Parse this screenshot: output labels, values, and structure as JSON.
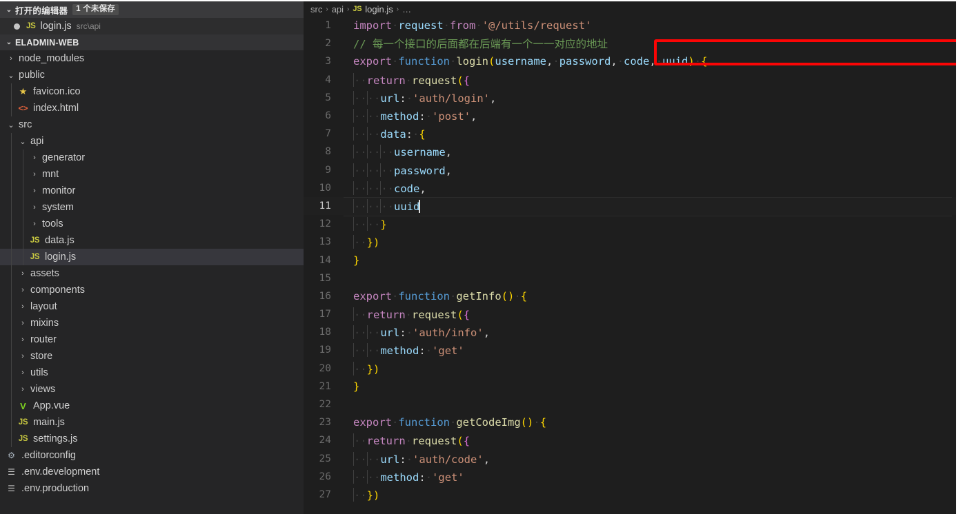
{
  "sidebar": {
    "open_editors": {
      "title": "打开的编辑器",
      "badge": "1 个未保存",
      "chevron": "⌄",
      "items": [
        {
          "name": "login.js",
          "path": "src\\api",
          "icon": "js-file-icon",
          "badge": "JS",
          "dirty": true
        }
      ]
    },
    "project": {
      "title": "ELADMIN-WEB",
      "chevron": "⌄"
    },
    "tree": [
      {
        "label": "node_modules",
        "type": "folder",
        "expanded": false,
        "depth": 0,
        "icon": "chevron-right-icon",
        "glyph": "›"
      },
      {
        "label": "public",
        "type": "folder",
        "expanded": true,
        "depth": 0,
        "icon": "chevron-down-icon",
        "glyph": "⌄"
      },
      {
        "label": "favicon.ico",
        "type": "file",
        "depth": 1,
        "icon": "star-icon",
        "glyph": "★",
        "iconClass": "ic-star"
      },
      {
        "label": "index.html",
        "type": "file",
        "depth": 1,
        "icon": "html-icon",
        "glyph": "<>",
        "iconClass": "ic-html"
      },
      {
        "label": "src",
        "type": "folder",
        "expanded": true,
        "depth": 0,
        "icon": "chevron-down-icon",
        "glyph": "⌄"
      },
      {
        "label": "api",
        "type": "folder",
        "expanded": true,
        "depth": 1,
        "icon": "chevron-down-icon",
        "glyph": "⌄"
      },
      {
        "label": "generator",
        "type": "folder",
        "expanded": false,
        "depth": 2,
        "icon": "chevron-right-icon",
        "glyph": "›"
      },
      {
        "label": "mnt",
        "type": "folder",
        "expanded": false,
        "depth": 2,
        "icon": "chevron-right-icon",
        "glyph": "›"
      },
      {
        "label": "monitor",
        "type": "folder",
        "expanded": false,
        "depth": 2,
        "icon": "chevron-right-icon",
        "glyph": "›"
      },
      {
        "label": "system",
        "type": "folder",
        "expanded": false,
        "depth": 2,
        "icon": "chevron-right-icon",
        "glyph": "›"
      },
      {
        "label": "tools",
        "type": "folder",
        "expanded": false,
        "depth": 2,
        "icon": "chevron-right-icon",
        "glyph": "›"
      },
      {
        "label": "data.js",
        "type": "file",
        "depth": 2,
        "icon": "js-file-icon",
        "glyph": "JS",
        "iconClass": "ic-js"
      },
      {
        "label": "login.js",
        "type": "file",
        "depth": 2,
        "icon": "js-file-icon",
        "glyph": "JS",
        "iconClass": "ic-js",
        "selected": true
      },
      {
        "label": "assets",
        "type": "folder",
        "expanded": false,
        "depth": 1,
        "icon": "chevron-right-icon",
        "glyph": "›"
      },
      {
        "label": "components",
        "type": "folder",
        "expanded": false,
        "depth": 1,
        "icon": "chevron-right-icon",
        "glyph": "›"
      },
      {
        "label": "layout",
        "type": "folder",
        "expanded": false,
        "depth": 1,
        "icon": "chevron-right-icon",
        "glyph": "›"
      },
      {
        "label": "mixins",
        "type": "folder",
        "expanded": false,
        "depth": 1,
        "icon": "chevron-right-icon",
        "glyph": "›"
      },
      {
        "label": "router",
        "type": "folder",
        "expanded": false,
        "depth": 1,
        "icon": "chevron-right-icon",
        "glyph": "›"
      },
      {
        "label": "store",
        "type": "folder",
        "expanded": false,
        "depth": 1,
        "icon": "chevron-right-icon",
        "glyph": "›"
      },
      {
        "label": "utils",
        "type": "folder",
        "expanded": false,
        "depth": 1,
        "icon": "chevron-right-icon",
        "glyph": "›"
      },
      {
        "label": "views",
        "type": "folder",
        "expanded": false,
        "depth": 1,
        "icon": "chevron-right-icon",
        "glyph": "›"
      },
      {
        "label": "App.vue",
        "type": "file",
        "depth": 1,
        "icon": "vue-icon",
        "glyph": "V",
        "iconClass": "ic-vue"
      },
      {
        "label": "main.js",
        "type": "file",
        "depth": 1,
        "icon": "js-file-icon",
        "glyph": "JS",
        "iconClass": "ic-js"
      },
      {
        "label": "settings.js",
        "type": "file",
        "depth": 1,
        "icon": "js-file-icon",
        "glyph": "JS",
        "iconClass": "ic-js"
      },
      {
        "label": ".editorconfig",
        "type": "file",
        "depth": 0,
        "icon": "gear-icon",
        "glyph": "⚙",
        "iconClass": "ic-gear"
      },
      {
        "label": ".env.development",
        "type": "file",
        "depth": 0,
        "icon": "config-lines-icon",
        "glyph": "☰",
        "iconClass": "ic-lines"
      },
      {
        "label": ".env.production",
        "type": "file",
        "depth": 0,
        "icon": "config-lines-icon",
        "glyph": "☰",
        "iconClass": "ic-lines"
      }
    ]
  },
  "breadcrumb": {
    "segments": [
      "src",
      "api"
    ],
    "file": "login.js",
    "file_badge": "JS",
    "ellipsis": "…",
    "separator": "›"
  },
  "editor": {
    "file": "login.js",
    "active_line": 11,
    "cursor_after": "uuid",
    "lines": [
      {
        "n": 1,
        "text": "import request from '@/utils/request'"
      },
      {
        "n": 2,
        "text": "// 每一个接口的后面都在后端有一个一一对应的地址"
      },
      {
        "n": 3,
        "text": "export function login(username, password, code, uuid) {"
      },
      {
        "n": 4,
        "text": "  return request({"
      },
      {
        "n": 5,
        "text": "    url: 'auth/login',"
      },
      {
        "n": 6,
        "text": "    method: 'post',"
      },
      {
        "n": 7,
        "text": "    data: {"
      },
      {
        "n": 8,
        "text": "      username,"
      },
      {
        "n": 9,
        "text": "      password,"
      },
      {
        "n": 10,
        "text": "      code,"
      },
      {
        "n": 11,
        "text": "      uuid"
      },
      {
        "n": 12,
        "text": "    }"
      },
      {
        "n": 13,
        "text": "  })"
      },
      {
        "n": 14,
        "text": "}"
      },
      {
        "n": 15,
        "text": ""
      },
      {
        "n": 16,
        "text": "export function getInfo() {"
      },
      {
        "n": 17,
        "text": "  return request({"
      },
      {
        "n": 18,
        "text": "    url: 'auth/info',"
      },
      {
        "n": 19,
        "text": "    method: 'get'"
      },
      {
        "n": 20,
        "text": "  })"
      },
      {
        "n": 21,
        "text": "}"
      },
      {
        "n": 22,
        "text": ""
      },
      {
        "n": 23,
        "text": "export function getCodeImg() {"
      },
      {
        "n": 24,
        "text": "  return request({"
      },
      {
        "n": 25,
        "text": "    url: 'auth/code',"
      },
      {
        "n": 26,
        "text": "    method: 'get'"
      },
      {
        "n": 27,
        "text": "  })"
      }
    ]
  },
  "annotation": {
    "shape": "rectangle",
    "color": "#fb0505",
    "target_line": 2,
    "target_text": "// 每一个接口的后面都在后端有一个一一对应的地址"
  },
  "colors": {
    "editor_background": "#1e1e1e",
    "sidebar_background": "#252526",
    "selection": "#37373d",
    "accent_red": "#fb0505",
    "comment_green": "#6a9955",
    "keyword_purple": "#c586c0",
    "keyword_blue": "#569cd6",
    "string_orange": "#ce9178",
    "function_yellow": "#dcdcaa",
    "variable_blue": "#9cdcfe"
  }
}
